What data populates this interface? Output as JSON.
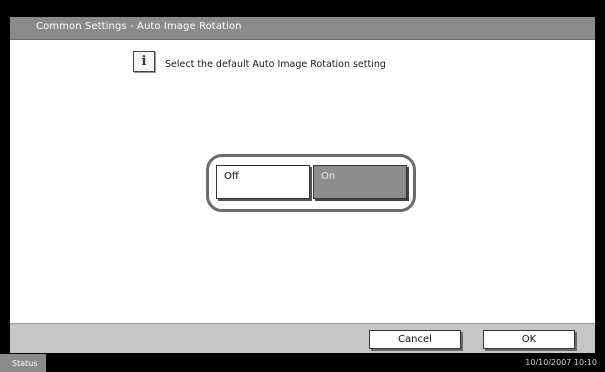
{
  "title": "Common Settings - Auto Image Rotation",
  "message": "Select the default Auto Image Rotation setting",
  "info_icon_glyph": "i",
  "options": {
    "off_label": "Off",
    "on_label": "On",
    "selected": "On"
  },
  "footer": {
    "cancel_label": "Cancel",
    "ok_label": "OK"
  },
  "status_bar": {
    "status_label": "Status",
    "datetime": "10/10/2007   10:10"
  },
  "colors": {
    "title_bar": "#8a8a8a",
    "selected_button": "#8d8d8d",
    "footer_bg": "#c6c6c6"
  }
}
